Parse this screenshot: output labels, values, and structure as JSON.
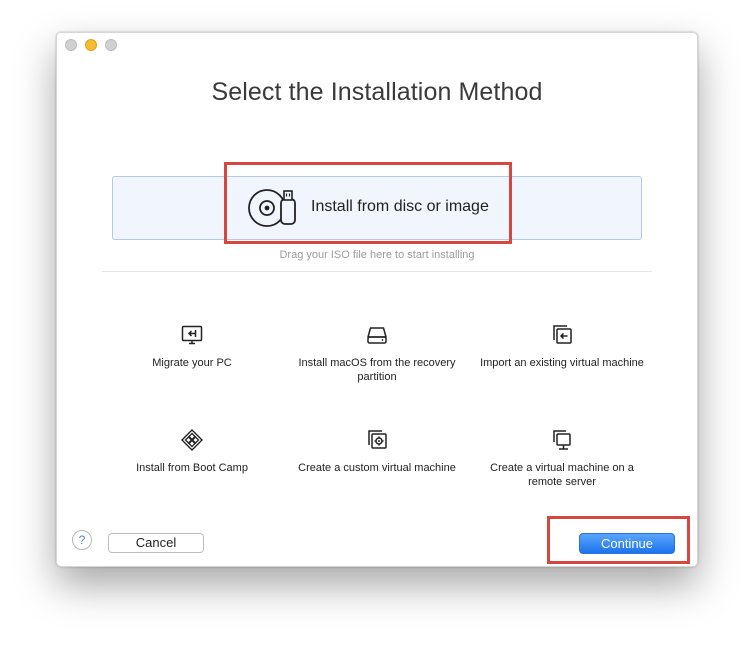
{
  "window": {
    "title": "Select the Installation Method"
  },
  "primary_option": {
    "label": "Install from disc or image",
    "hint": "Drag your ISO file here to start installing",
    "icon": "disc-usb-icon"
  },
  "options": [
    {
      "label": "Migrate your PC",
      "icon": "monitor-import-icon"
    },
    {
      "label": "Install macOS from the recovery partition",
      "icon": "hard-drive-icon"
    },
    {
      "label": "Import an existing virtual machine",
      "icon": "import-vm-icon"
    },
    {
      "label": "Install from Boot Camp",
      "icon": "boot-camp-icon"
    },
    {
      "label": "Create a custom virtual machine",
      "icon": "custom-vm-gear-icon"
    },
    {
      "label": "Create a virtual machine on a remote server",
      "icon": "remote-server-icon"
    }
  ],
  "footer": {
    "help_label": "?",
    "cancel_label": "Cancel",
    "continue_label": "Continue"
  },
  "colors": {
    "accent": "#1b73ee",
    "highlight": "#d7473f",
    "dropzone_bg": "#f1f5fd"
  }
}
